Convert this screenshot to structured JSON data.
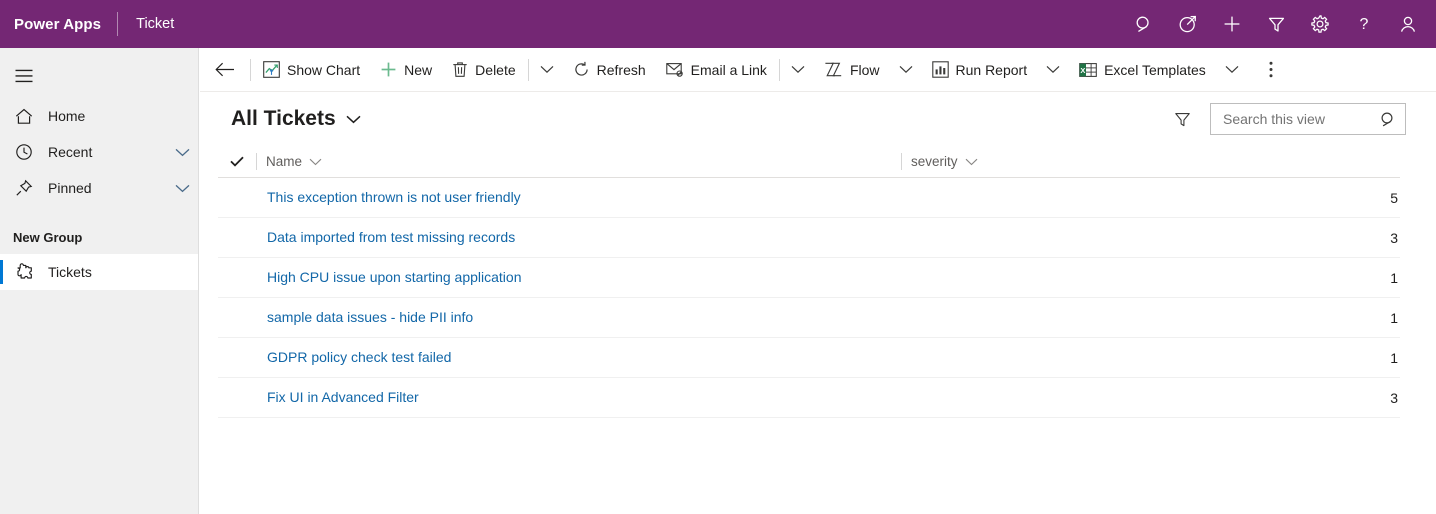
{
  "header": {
    "brand": "Power Apps",
    "app_name": "Ticket",
    "background_color": "#742774",
    "icons": [
      {
        "name": "search-icon",
        "label": "Search"
      },
      {
        "name": "diagnostics-icon",
        "label": "Diagnostics"
      },
      {
        "name": "new-icon",
        "label": "New"
      },
      {
        "name": "filter-icon",
        "label": "Filter"
      },
      {
        "name": "settings-gear-icon",
        "label": "Settings"
      },
      {
        "name": "help-icon",
        "label": "Help"
      },
      {
        "name": "account-icon",
        "label": "Account manager"
      }
    ]
  },
  "sidebar": {
    "background_color": "#f0f0f0",
    "menu_label": "Site map",
    "items": [
      {
        "label": "Home",
        "icon": "home-icon",
        "expandable": false
      },
      {
        "label": "Recent",
        "icon": "clock-icon",
        "expandable": true
      },
      {
        "label": "Pinned",
        "icon": "pin-icon",
        "expandable": true
      }
    ],
    "group_title": "New Group",
    "group_items": [
      {
        "label": "Tickets",
        "icon": "puzzle-icon",
        "selected": true
      }
    ],
    "selected_accent_color": "#0078d4"
  },
  "commandbar": {
    "back_label": "Back",
    "items": [
      {
        "label": "Show Chart",
        "icon": "show-chart-icon",
        "caret": false
      },
      {
        "label": "New",
        "icon": "plus-icon",
        "caret": false
      },
      {
        "label": "Delete",
        "icon": "trash-icon",
        "caret": false
      },
      {
        "label": "",
        "icon": "chevron-down-icon",
        "caret": true
      },
      {
        "label": "Refresh",
        "icon": "refresh-icon",
        "caret": false
      },
      {
        "label": "Email a Link",
        "icon": "email-link-icon",
        "caret": false
      },
      {
        "label": "",
        "icon": "chevron-down-icon",
        "caret": true
      },
      {
        "label": "Flow",
        "icon": "flow-icon",
        "caret": true
      },
      {
        "label": "Run Report",
        "icon": "report-icon",
        "caret": true
      },
      {
        "label": "Excel Templates",
        "icon": "excel-icon",
        "caret": true
      }
    ],
    "overflow_label": "More commands"
  },
  "view": {
    "title": "All Tickets",
    "filter_label": "Filter by",
    "search": {
      "placeholder": "Search this view",
      "value": ""
    }
  },
  "grid": {
    "select_all_label": "Select all",
    "columns": [
      {
        "key": "name",
        "label": "Name",
        "sortable": true
      },
      {
        "key": "severity",
        "label": "severity",
        "sortable": true
      }
    ],
    "rows": [
      {
        "name": "This exception thrown is not user friendly",
        "severity": "5"
      },
      {
        "name": "Data imported from test missing records",
        "severity": "3"
      },
      {
        "name": "High CPU issue upon starting application",
        "severity": "1"
      },
      {
        "name": "sample data issues - hide PII info",
        "severity": "1"
      },
      {
        "name": "GDPR policy check test failed",
        "severity": "1"
      },
      {
        "name": "Fix UI in Advanced Filter",
        "severity": "3"
      }
    ],
    "link_color": "#1267a8"
  }
}
